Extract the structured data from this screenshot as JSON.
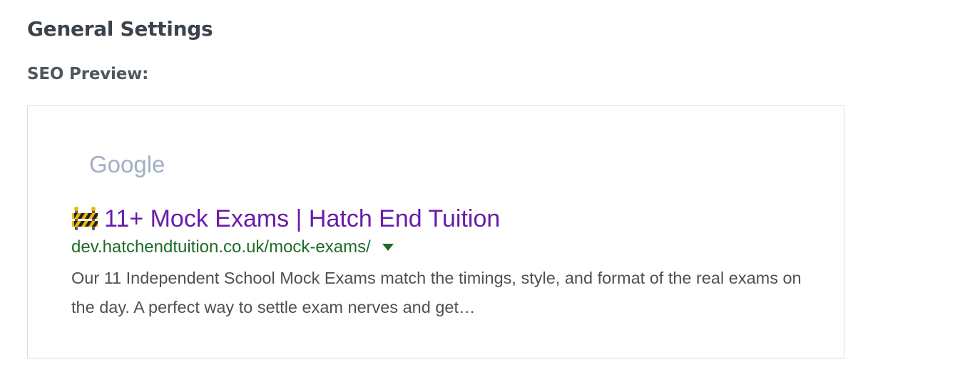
{
  "page": {
    "title": "General Settings",
    "section_label": "SEO Preview:"
  },
  "seo_preview": {
    "search_engine": "Google",
    "title_icon": "construction-barrier-icon",
    "title": "11+ Mock Exams | Hatch End Tuition",
    "url": "dev.hatchendtuition.co.uk/mock-exams/",
    "url_menu_icon": "caret-down-icon",
    "description": "Our 11 Independent School Mock Exams match the timings, style, and format of the real exams on the day. A perfect way to settle exam nerves and get…"
  },
  "colors": {
    "heading": "#3c434a",
    "label": "#50575e",
    "google_logo": "#a2b0c3",
    "result_title": "#681da8",
    "result_url": "#1e6b28",
    "description": "#4d5156",
    "border": "#dcdcde"
  }
}
